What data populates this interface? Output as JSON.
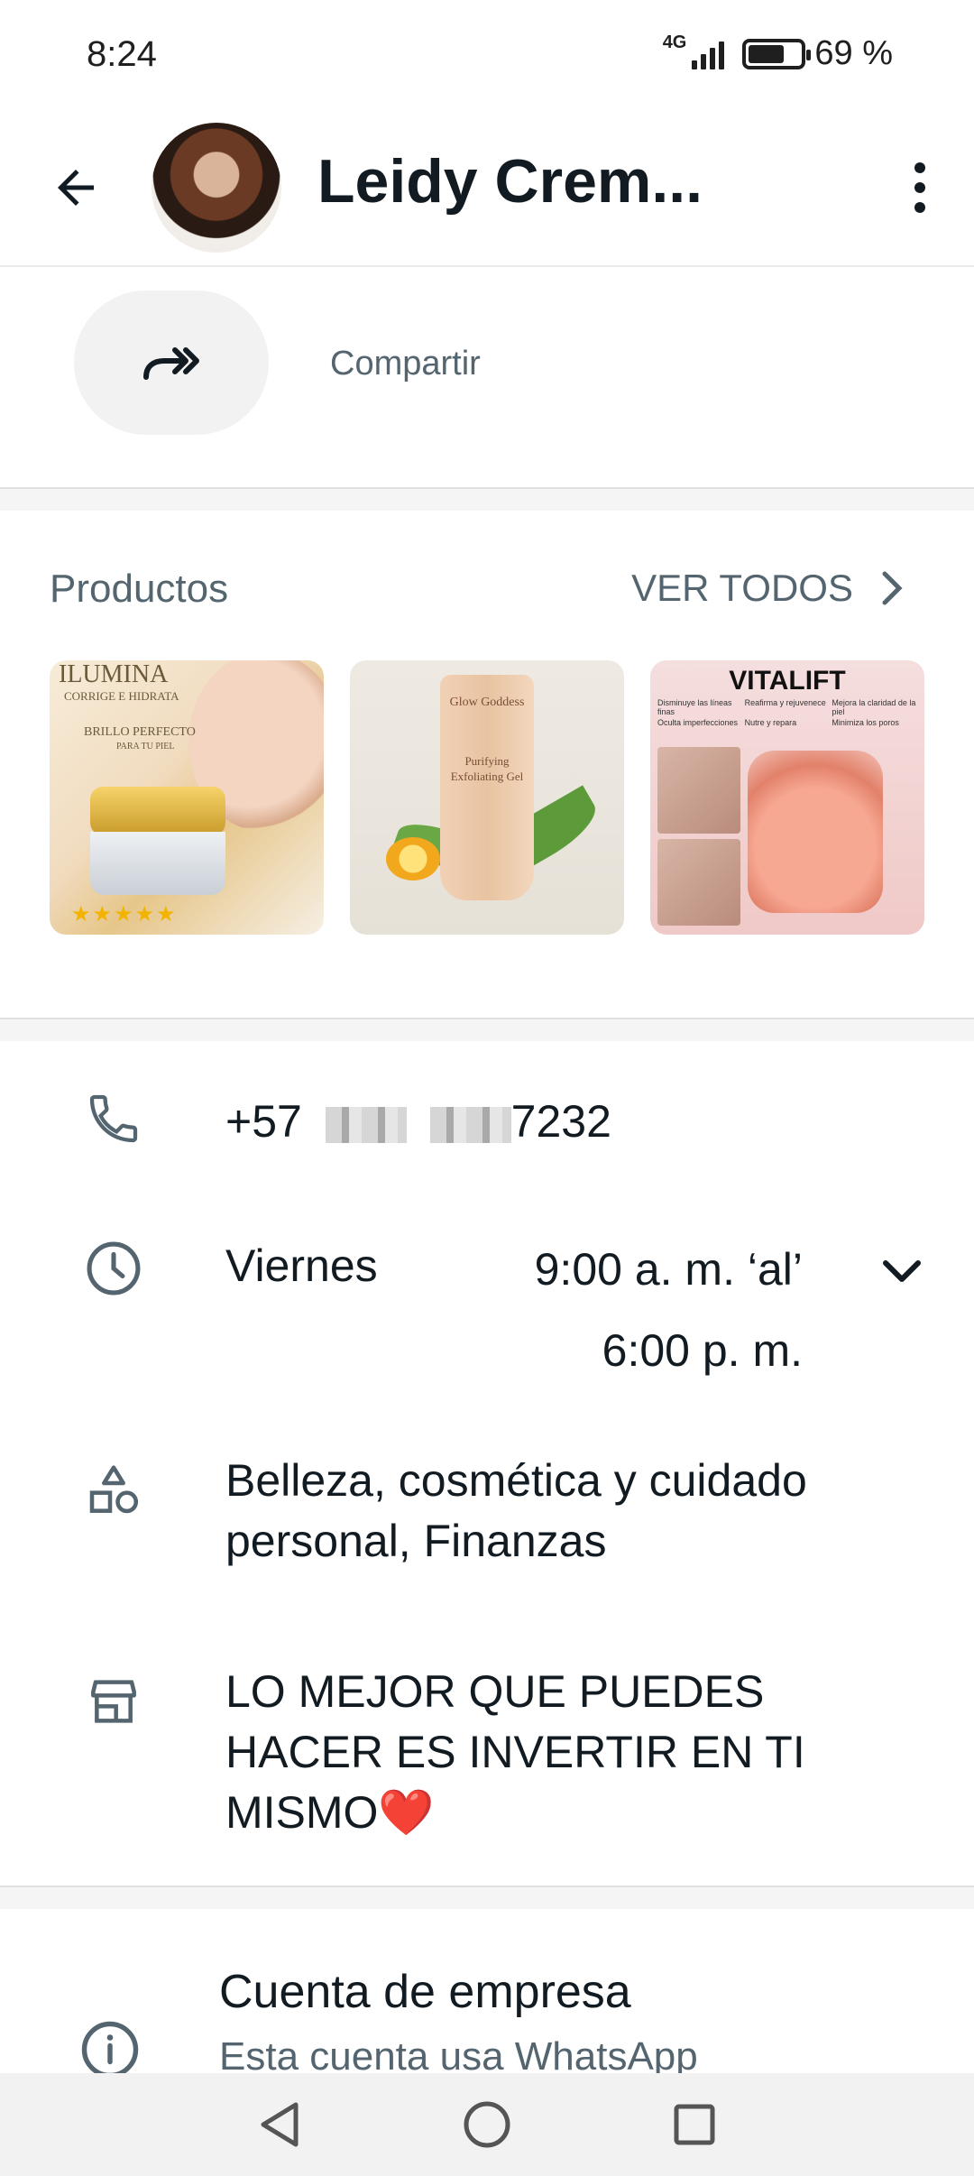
{
  "status_bar": {
    "time": "8:24",
    "network": "4G",
    "battery": "69 %",
    "battery_level": 0.69
  },
  "header": {
    "title": "Leidy Crem...",
    "back_icon": "arrow-left-icon",
    "menu_icon": "more-vert-icon"
  },
  "share": {
    "label": "Compartir",
    "icon": "forward-share-icon"
  },
  "products": {
    "title": "Productos",
    "view_all": "VER TODOS",
    "items": [
      {
        "brand": "ILUMINA",
        "tagline": "CORRIGE E HIDRATA",
        "headline": "BRILLO PERFECTO",
        "subline": "PARA TU PIEL",
        "stars": "★★★★★"
      },
      {
        "brand": "Glow Goddess",
        "name": "Purifying Exfoliating Gel"
      },
      {
        "brand": "VITALIFT",
        "benefits": [
          "Disminuye las líneas finas",
          "Reafirma y rejuvenece",
          "Mejora la claridad de la piel",
          "Oculta imperfecciones",
          "Nutre y repara",
          "Minimiza los poros"
        ]
      }
    ]
  },
  "info": {
    "phone_prefix": "+57",
    "phone_suffix": "7232",
    "hours_day": "Viernes",
    "hours_open": "9:00 a. m. ‘al’",
    "hours_close": "6:00 p. m.",
    "category_line1": "Belleza, cosmética y cuidado",
    "category_line2": "personal, Finanzas",
    "description_line1": "LO MEJOR QUE PUEDES",
    "description_line2": "HACER ES INVERTIR EN TI",
    "description_line3": "MISMO❤️"
  },
  "business": {
    "title": "Cuenta de empresa",
    "subtitle": "Esta cuenta usa WhatsApp"
  },
  "colors": {
    "primary_text": "#111b21",
    "secondary_text": "#54656f",
    "surface": "#ffffff",
    "divider": "#f5f5f5",
    "nav_bar": "#f2f2f2"
  }
}
